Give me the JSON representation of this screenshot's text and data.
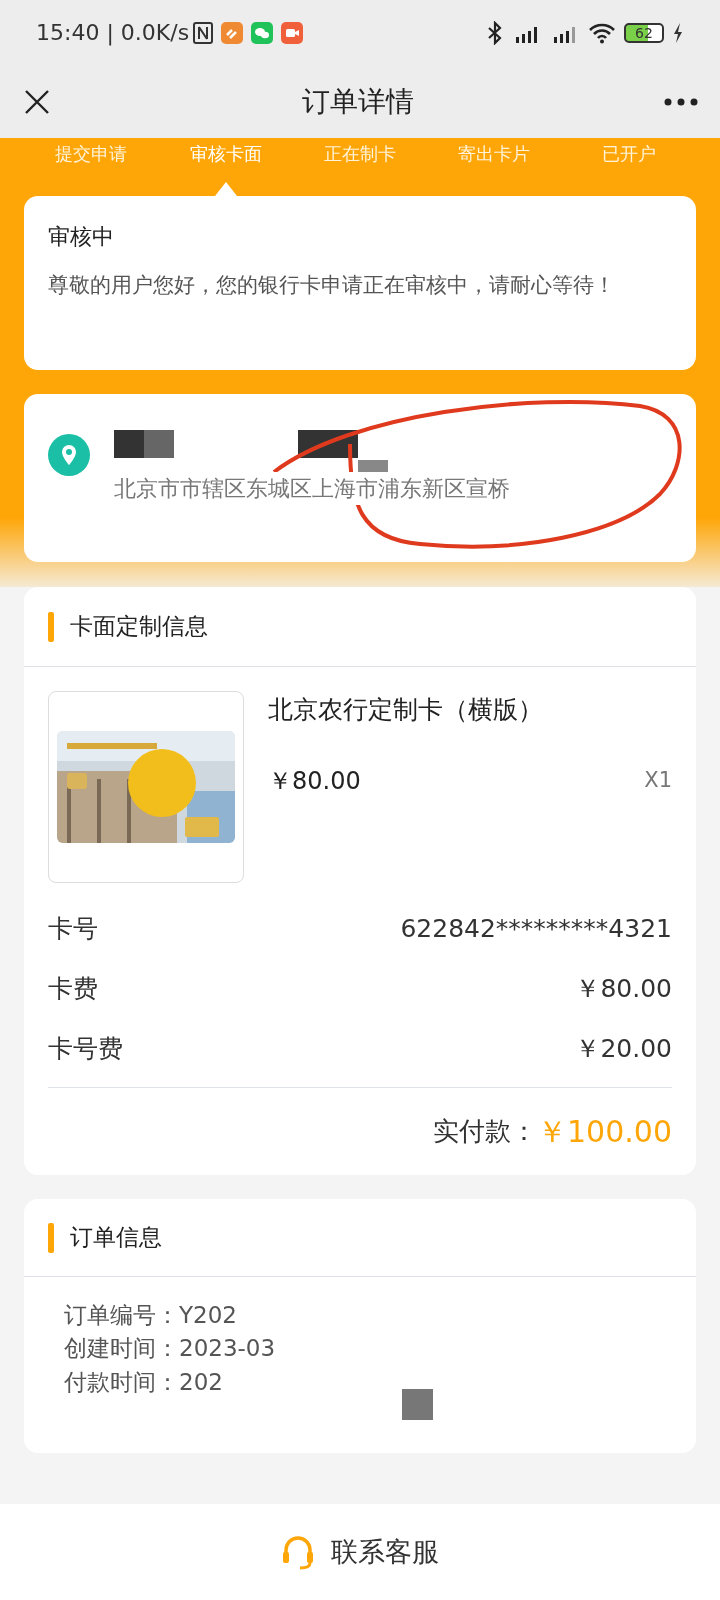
{
  "status_bar": {
    "time": "15:40 | 0.0K/s",
    "battery": "62"
  },
  "header": {
    "title": "订单详情"
  },
  "steps": [
    {
      "label": "提交申请",
      "selected": false
    },
    {
      "label": "审核卡面",
      "selected": true
    },
    {
      "label": "正在制卡",
      "selected": false
    },
    {
      "label": "寄出卡片",
      "selected": false
    },
    {
      "label": "已开户",
      "selected": false
    }
  ],
  "status_card": {
    "title": "审核中",
    "message": "尊敬的用户您好，您的银行卡申请正在审核中，请耐心等待！"
  },
  "address": {
    "text": "北京市市辖区东城区上海市浦东新区宣桥"
  },
  "card_info": {
    "title": "卡面定制信息",
    "product": {
      "name": "北京农行定制卡（横版）",
      "price": "￥80.00",
      "quantity": "X1"
    },
    "rows": [
      {
        "label": "卡号",
        "value": "622842*********4321"
      },
      {
        "label": "卡费",
        "value": "￥80.00"
      },
      {
        "label": "卡号费",
        "value": "￥20.00"
      }
    ],
    "total_label": "实付款：",
    "total": "￥100.00"
  },
  "order_info": {
    "title": "订单信息",
    "rows": [
      {
        "label": "订单编号：",
        "value": "Y202"
      },
      {
        "label": "创建时间：",
        "value": "2023-03"
      },
      {
        "label": "付款时间：",
        "value": "202"
      }
    ]
  },
  "footer": {
    "label": "联系客服"
  }
}
